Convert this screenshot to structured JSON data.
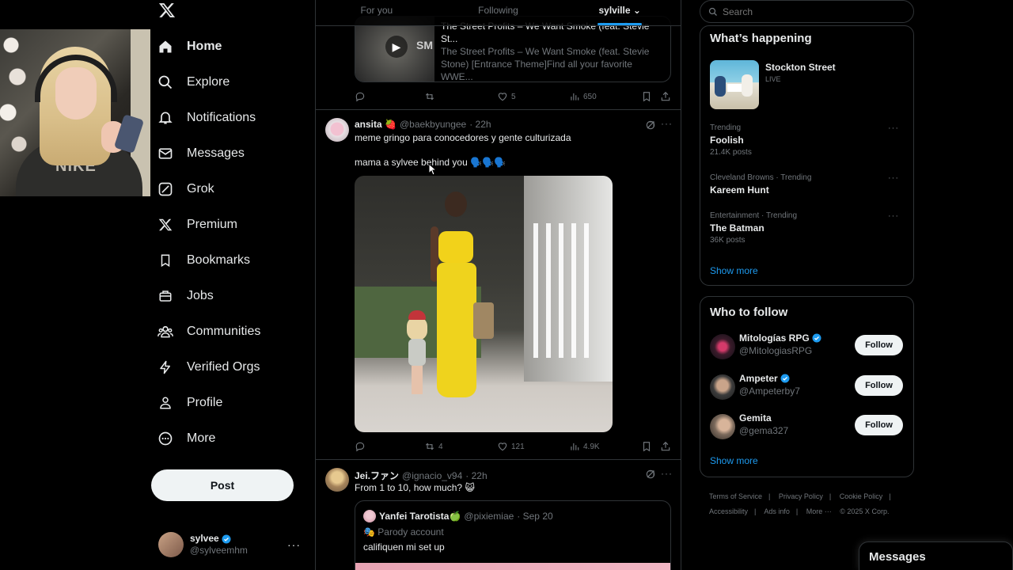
{
  "nav": {
    "items": [
      {
        "label": "Home",
        "icon": "home-icon"
      },
      {
        "label": "Explore",
        "icon": "search-icon"
      },
      {
        "label": "Notifications",
        "icon": "bell-icon"
      },
      {
        "label": "Messages",
        "icon": "mail-icon"
      },
      {
        "label": "Grok",
        "icon": "grok-icon"
      },
      {
        "label": "Premium",
        "icon": "x-logo-icon"
      },
      {
        "label": "Bookmarks",
        "icon": "bookmark-icon"
      },
      {
        "label": "Jobs",
        "icon": "briefcase-icon"
      },
      {
        "label": "Communities",
        "icon": "people-icon"
      },
      {
        "label": "Verified Orgs",
        "icon": "lightning-icon"
      },
      {
        "label": "Profile",
        "icon": "person-icon"
      },
      {
        "label": "More",
        "icon": "more-circle-icon"
      }
    ],
    "post_label": "Post",
    "account": {
      "name": "sylvee",
      "handle": "@sylveemhm",
      "more": "···"
    }
  },
  "tabs": [
    {
      "label": "For you"
    },
    {
      "label": "Following"
    },
    {
      "label": "sylville ⌄",
      "active": true
    }
  ],
  "tweets": [
    {
      "card_title": "The Street Profits – We Want Smoke (feat. Stevie St...",
      "card_desc": "The Street Profits – We Want Smoke (feat. Stevie Stone) [Entrance Theme]Find all your favorite WWE...",
      "card_logo": "SM",
      "actions": {
        "reply": "",
        "repost": "",
        "like": "5",
        "views": "650"
      }
    },
    {
      "name": "ansita 🍓",
      "handle": "@baekbyungee",
      "time": "· 22h",
      "text1": "meme gringo para conocedores y gente culturizada",
      "text2": "mama a sylvee behind you 🗣️🗣️🗣️",
      "actions": {
        "reply": "",
        "repost": "4",
        "like": "121",
        "views": "4.9K"
      }
    },
    {
      "name": "Jei.ファン",
      "handle": "@ignacio_v94",
      "time": "· 22h",
      "text1": "From 1 to 10, how much? 😺",
      "quote": {
        "name": "Yanfei Tarotista🍏",
        "handle": "@pixiemiae",
        "time": "· Sep 20",
        "sub": "🎭 Parody account",
        "text": "califiquen mi set up"
      }
    }
  ],
  "search": {
    "placeholder": "Search"
  },
  "happening": {
    "title": "What’s happening",
    "feature": {
      "name": "Stockton Street",
      "status": "LIVE"
    },
    "trends": [
      {
        "category": "Trending",
        "name": "Foolish",
        "count": "21.4K posts"
      },
      {
        "category": "Cleveland Browns · Trending",
        "name": "Kareem Hunt",
        "count": ""
      },
      {
        "category": "Entertainment · Trending",
        "name": "The Batman",
        "count": "36K posts"
      }
    ],
    "show_more": "Show more"
  },
  "who_to_follow": {
    "title": "Who to follow",
    "accounts": [
      {
        "name": "Mitologías RPG",
        "handle": "@MitologiasRPG",
        "verified": true,
        "button": "Follow"
      },
      {
        "name": "Ampeter",
        "handle": "@Ampeterby7",
        "verified": true,
        "button": "Follow"
      },
      {
        "name": "Gemita",
        "handle": "@gema327",
        "verified": false,
        "button": "Follow"
      }
    ],
    "show_more": "Show more"
  },
  "footer": {
    "links": [
      "Terms of Service",
      "|",
      "Privacy Policy",
      "|",
      "Cookie Policy",
      "|",
      "Accessibility",
      "|",
      "Ads info",
      "|",
      "More ···",
      "© 2025 X Corp."
    ]
  },
  "messages_bar": {
    "label": "Messages"
  },
  "colors": {
    "accent": "#1d9bf0",
    "background": "#000000",
    "border": "#2f3336",
    "muted": "#71767b",
    "text": "#e7e9ea"
  }
}
